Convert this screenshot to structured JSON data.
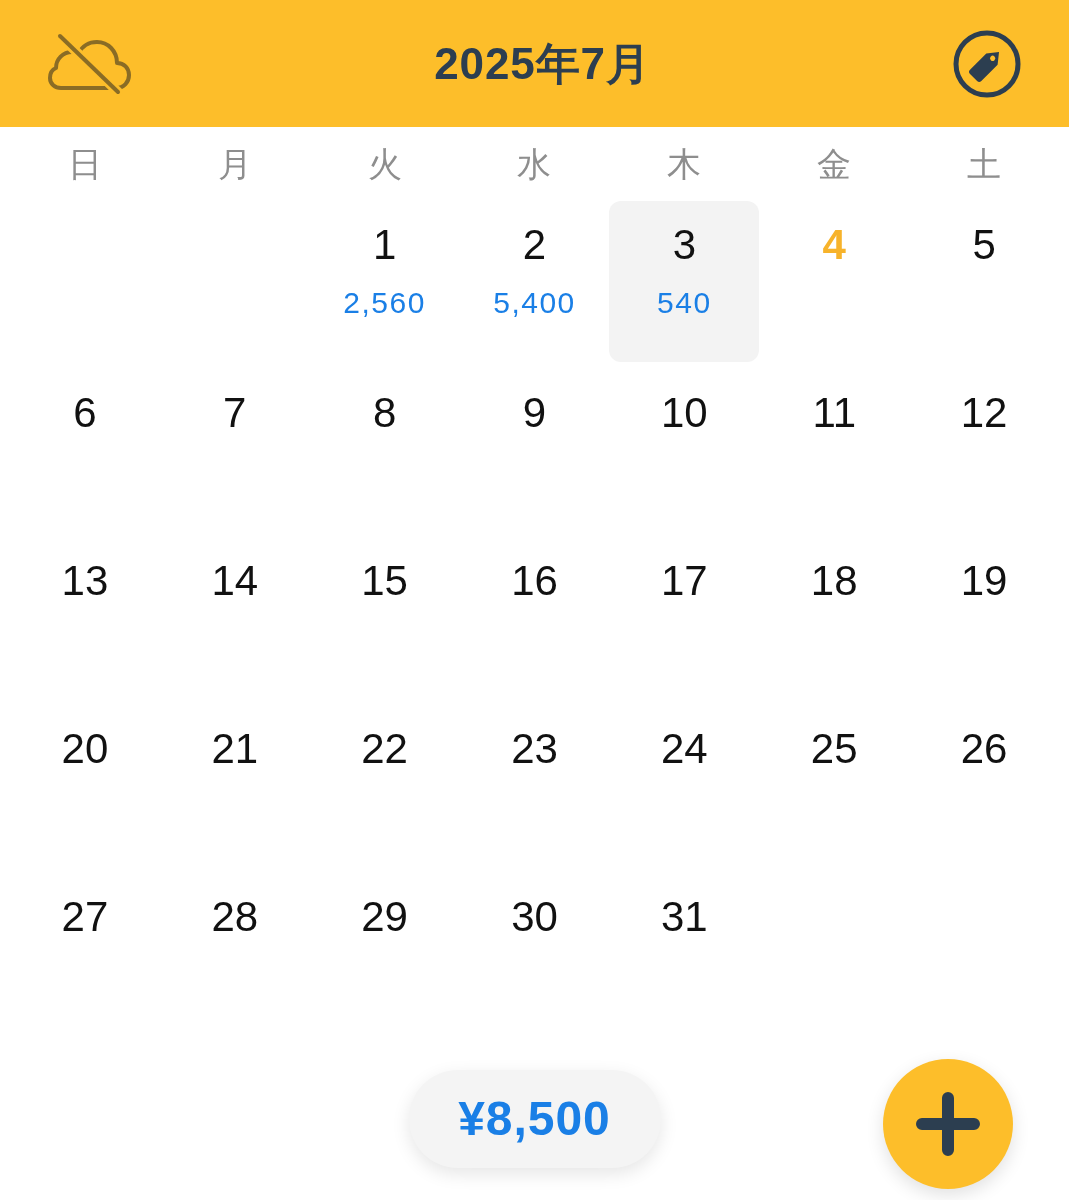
{
  "header": {
    "title": "2025年7月"
  },
  "weekdays": [
    "日",
    "月",
    "火",
    "水",
    "木",
    "金",
    "土"
  ],
  "weeks": [
    {
      "days": [
        {
          "kind": "empty"
        },
        {
          "kind": "empty"
        },
        {
          "kind": "day",
          "day": "1",
          "amount": "2,560",
          "selected": false,
          "today": false
        },
        {
          "kind": "day",
          "day": "2",
          "amount": "5,400",
          "selected": false,
          "today": false
        },
        {
          "kind": "day",
          "day": "3",
          "amount": "540",
          "selected": true,
          "today": false
        },
        {
          "kind": "day",
          "day": "4",
          "selected": false,
          "today": true
        },
        {
          "kind": "day",
          "day": "5",
          "selected": false,
          "today": false
        }
      ]
    },
    {
      "days": [
        {
          "kind": "day",
          "day": "6",
          "selected": false,
          "today": false
        },
        {
          "kind": "day",
          "day": "7",
          "selected": false,
          "today": false
        },
        {
          "kind": "day",
          "day": "8",
          "selected": false,
          "today": false
        },
        {
          "kind": "day",
          "day": "9",
          "selected": false,
          "today": false
        },
        {
          "kind": "day",
          "day": "10",
          "selected": false,
          "today": false
        },
        {
          "kind": "day",
          "day": "11",
          "selected": false,
          "today": false
        },
        {
          "kind": "day",
          "day": "12",
          "selected": false,
          "today": false
        }
      ]
    },
    {
      "days": [
        {
          "kind": "day",
          "day": "13",
          "selected": false,
          "today": false
        },
        {
          "kind": "day",
          "day": "14",
          "selected": false,
          "today": false
        },
        {
          "kind": "day",
          "day": "15",
          "selected": false,
          "today": false
        },
        {
          "kind": "day",
          "day": "16",
          "selected": false,
          "today": false
        },
        {
          "kind": "day",
          "day": "17",
          "selected": false,
          "today": false
        },
        {
          "kind": "day",
          "day": "18",
          "selected": false,
          "today": false
        },
        {
          "kind": "day",
          "day": "19",
          "selected": false,
          "today": false
        }
      ]
    },
    {
      "days": [
        {
          "kind": "day",
          "day": "20",
          "selected": false,
          "today": false
        },
        {
          "kind": "day",
          "day": "21",
          "selected": false,
          "today": false
        },
        {
          "kind": "day",
          "day": "22",
          "selected": false,
          "today": false
        },
        {
          "kind": "day",
          "day": "23",
          "selected": false,
          "today": false
        },
        {
          "kind": "day",
          "day": "24",
          "selected": false,
          "today": false
        },
        {
          "kind": "day",
          "day": "25",
          "selected": false,
          "today": false
        },
        {
          "kind": "day",
          "day": "26",
          "selected": false,
          "today": false
        }
      ]
    },
    {
      "days": [
        {
          "kind": "day",
          "day": "27",
          "selected": false,
          "today": false
        },
        {
          "kind": "day",
          "day": "28",
          "selected": false,
          "today": false
        },
        {
          "kind": "day",
          "day": "29",
          "selected": false,
          "today": false
        },
        {
          "kind": "day",
          "day": "30",
          "selected": false,
          "today": false
        },
        {
          "kind": "day",
          "day": "31",
          "selected": false,
          "today": false
        },
        {
          "kind": "empty"
        },
        {
          "kind": "empty"
        }
      ]
    }
  ],
  "total": {
    "amount": "¥8,500"
  }
}
